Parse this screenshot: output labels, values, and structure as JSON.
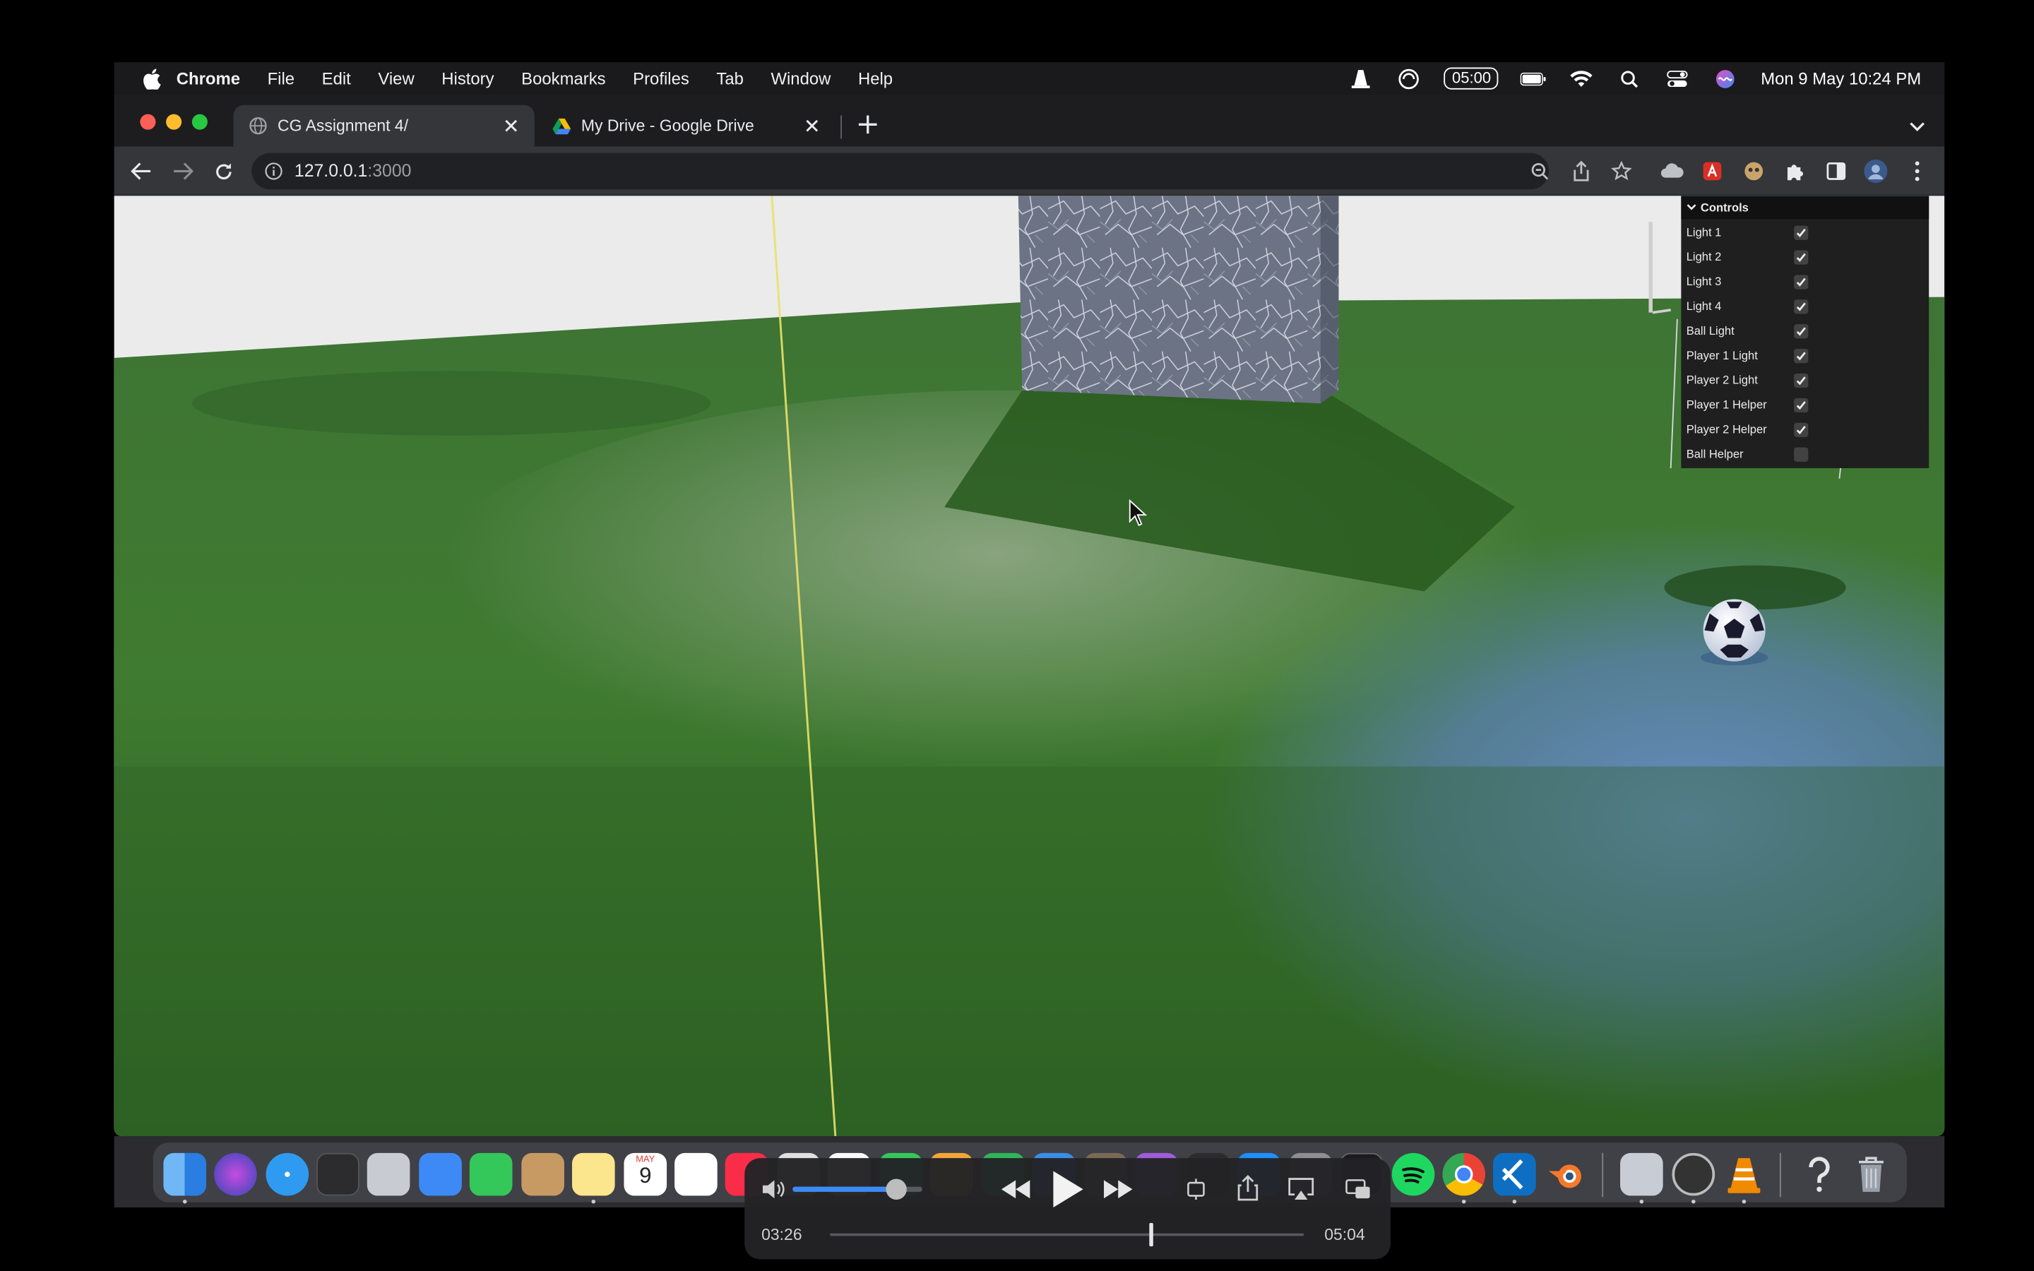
{
  "menubar": {
    "app_name": "Chrome",
    "menus": [
      "File",
      "Edit",
      "View",
      "History",
      "Bookmarks",
      "Profiles",
      "Tab",
      "Window",
      "Help"
    ],
    "timer": "05:00",
    "datetime": "Mon 9 May  10:24 PM"
  },
  "browser": {
    "tabs": [
      {
        "title": "CG Assignment 4/",
        "active": true
      },
      {
        "title": "My Drive - Google Drive",
        "active": false
      }
    ],
    "url_host": "127.0.0.1",
    "url_port": ":3000"
  },
  "controls": {
    "title": "Controls",
    "items": [
      {
        "label": "Light 1",
        "checked": true
      },
      {
        "label": "Light 2",
        "checked": true
      },
      {
        "label": "Light 3",
        "checked": true
      },
      {
        "label": "Light 4",
        "checked": true
      },
      {
        "label": "Ball Light",
        "checked": true
      },
      {
        "label": "Player 1 Light",
        "checked": true
      },
      {
        "label": "Player 2 Light",
        "checked": true
      },
      {
        "label": "Player 1 Helper",
        "checked": true
      },
      {
        "label": "Player 2 Helper",
        "checked": true
      },
      {
        "label": "Ball Helper",
        "checked": false
      }
    ]
  },
  "dock": {
    "calendar_month": "MAY",
    "calendar_day": "9"
  },
  "player": {
    "elapsed": "03:26",
    "duration": "05:04",
    "volume": 0.8,
    "progress": 0.678
  },
  "colors": {
    "accent": "#3d8af7",
    "grass": "#3f7a2f",
    "blue_light": "#5a7fb8"
  }
}
